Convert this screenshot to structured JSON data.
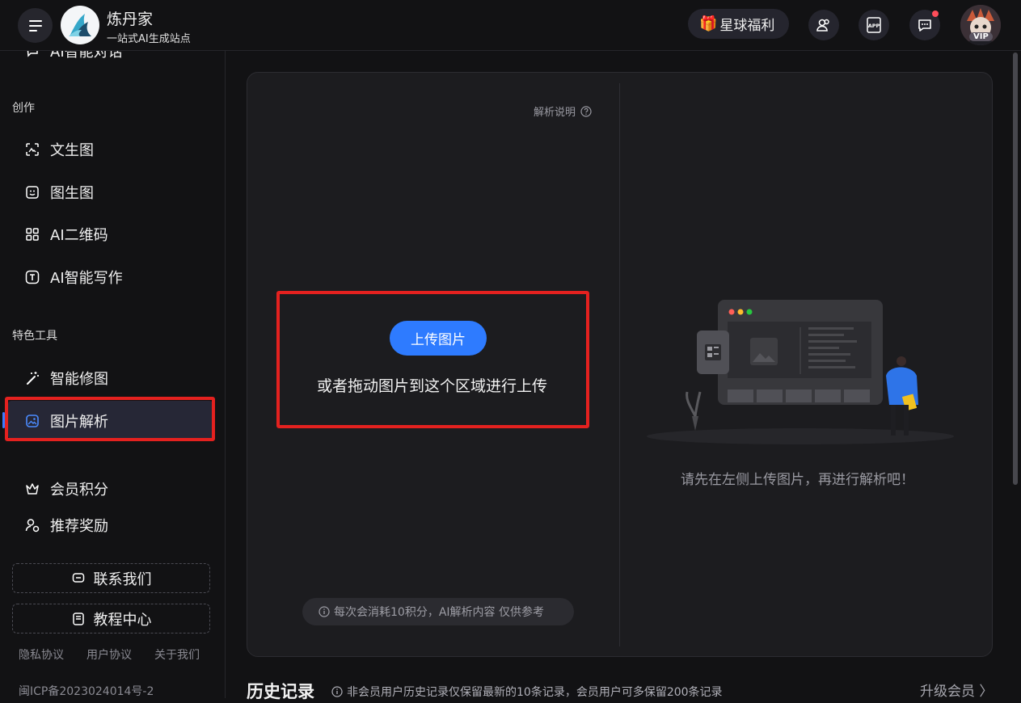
{
  "header": {
    "brand_name": "炼丹家",
    "brand_sub": "一站式AI生成站点",
    "welfare_label": "星球福利",
    "avatar_badge": "VIP"
  },
  "sidebar": {
    "clipped_item": "AI智能对话",
    "sections": [
      {
        "title": "创作",
        "items": [
          "文生图",
          "图生图",
          "AI二维码",
          "AI智能写作"
        ]
      },
      {
        "title": "特色工具",
        "items": [
          "智能修图",
          "图片解析"
        ]
      }
    ],
    "extra_items": [
      "会员积分",
      "推荐奖励"
    ],
    "buttons": [
      "联系我们",
      "教程中心"
    ],
    "footer_links": [
      "隐私协议",
      "用户协议",
      "关于我们"
    ],
    "icp": "闽ICP备2023024014号-2",
    "active_item": "图片解析"
  },
  "main": {
    "explain_label": "解析说明",
    "upload_button": "上传图片",
    "drag_text": "或者拖动图片到这个区域进行上传",
    "note": "每次会消耗10积分，AI解析内容 仅供参考",
    "empty_text": "请先在左侧上传图片，再进行解析吧！"
  },
  "history": {
    "title": "历史记录",
    "note": "非会员用户历史记录仅保留最新的10条记录，会员用户可多保留200条记录",
    "upgrade": "升级会员 〉"
  },
  "colors": {
    "accent": "#2e7bff",
    "highlight": "#e4211f",
    "background": "#121214",
    "panel": "#1c1c1f"
  }
}
